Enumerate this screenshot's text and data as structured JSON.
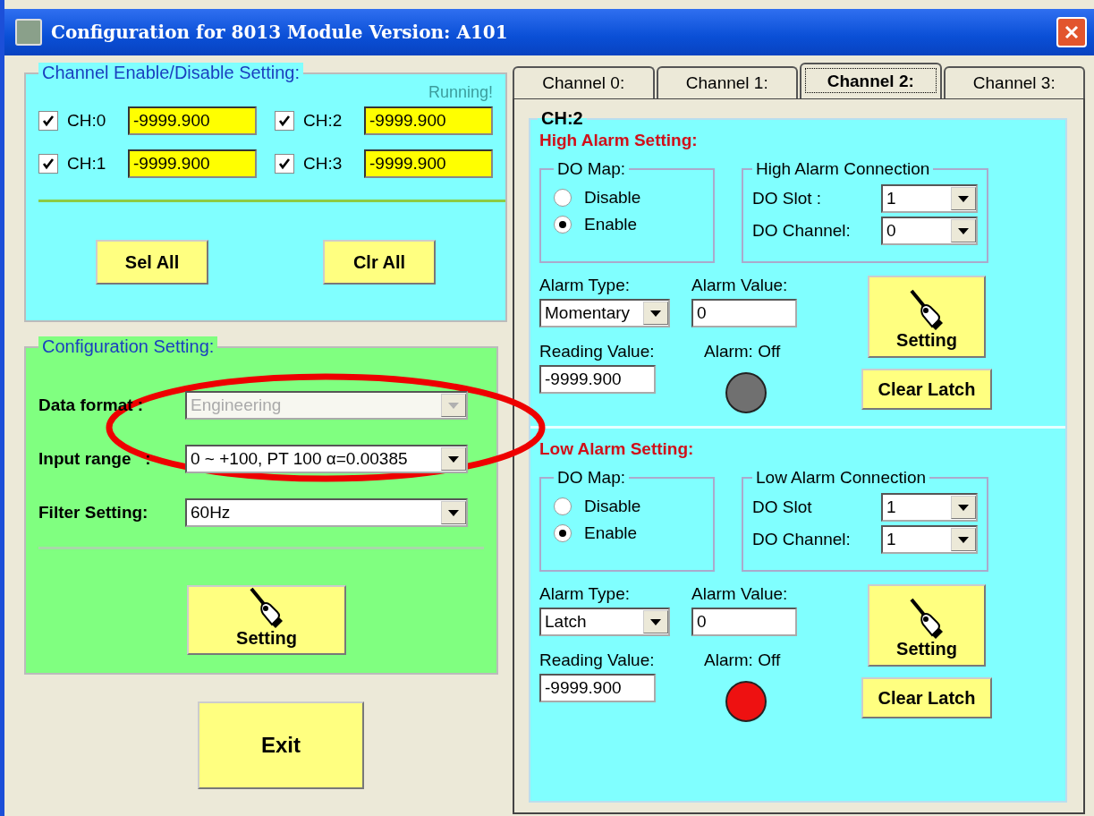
{
  "window": {
    "title": "Configuration for 8013 Module Version: A101"
  },
  "channel_panel": {
    "legend": "Channel Enable/Disable Setting:",
    "status": "Running!",
    "channels": [
      {
        "label": "CH:0",
        "checked": true,
        "value": "-9999.900"
      },
      {
        "label": "CH:1",
        "checked": true,
        "value": "-9999.900"
      },
      {
        "label": "CH:2",
        "checked": true,
        "value": "-9999.900"
      },
      {
        "label": "CH:3",
        "checked": true,
        "value": "-9999.900"
      }
    ],
    "buttons": [
      "Sel All",
      "Clr All"
    ]
  },
  "config_panel": {
    "legend": "Configuration Setting:",
    "fields": [
      {
        "label": "Data format :",
        "value": "Engineering",
        "disabled": true
      },
      {
        "label": "Input range   :",
        "value": "0 ~ +100, PT 100 α=0.00385",
        "disabled": false
      },
      {
        "label": "Filter Setting:",
        "value": "60Hz",
        "disabled": false
      }
    ],
    "button": "Setting"
  },
  "exit_button": "Exit",
  "tabs": [
    {
      "label": "Channel 0:",
      "selected": false
    },
    {
      "label": "Channel 1:",
      "selected": false
    },
    {
      "label": "Channel 2:",
      "selected": true
    },
    {
      "label": "Channel 3:",
      "selected": false
    }
  ],
  "channel_view": {
    "title": "CH:2",
    "sections": [
      {
        "heading": "High Alarm Setting:",
        "do_map": {
          "legend": "DO Map:",
          "options": [
            {
              "label": "Disable",
              "selected": false
            },
            {
              "label": "Enable",
              "selected": true
            }
          ]
        },
        "connection": {
          "legend": "High Alarm Connection",
          "fields": [
            {
              "label": "DO Slot :",
              "value": "1"
            },
            {
              "label": "DO Channel:",
              "value": "0"
            }
          ]
        },
        "alarm_type": {
          "label": "Alarm Type:",
          "value": "Momentary"
        },
        "alarm_value": {
          "label": "Alarm Value:",
          "value": "0"
        },
        "reading": {
          "label": "Reading Value:",
          "value": "-9999.900"
        },
        "alarm_status": {
          "label": "Alarm: Off",
          "color": "#707070"
        },
        "buttons": [
          "Setting",
          "Clear Latch"
        ]
      },
      {
        "heading": "Low Alarm Setting:",
        "do_map": {
          "legend": "DO Map:",
          "options": [
            {
              "label": "Disable",
              "selected": false
            },
            {
              "label": "Enable",
              "selected": true
            }
          ]
        },
        "connection": {
          "legend": "Low Alarm Connection",
          "fields": [
            {
              "label": "DO Slot",
              "value": "1"
            },
            {
              "label": "DO Channel:",
              "value": "1"
            }
          ]
        },
        "alarm_type": {
          "label": "Alarm Type:",
          "value": "Latch"
        },
        "alarm_value": {
          "label": "Alarm Value:",
          "value": "0"
        },
        "reading": {
          "label": "Reading Value:",
          "value": "-9999.900"
        },
        "alarm_status": {
          "label": "Alarm: Off",
          "color": "#ee1111"
        },
        "buttons": [
          "Setting",
          "Clear Latch"
        ]
      }
    ]
  }
}
